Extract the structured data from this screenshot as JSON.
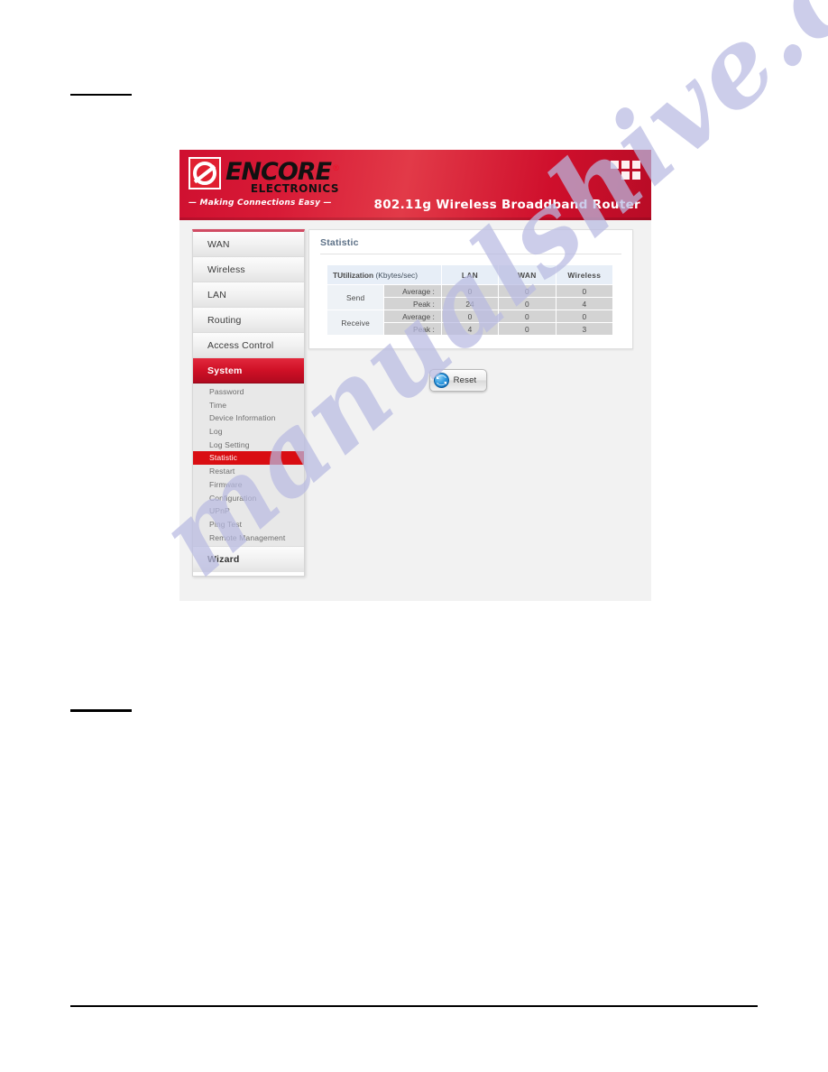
{
  "document": {
    "rules": {
      "top_rule": "",
      "mid_rule": "",
      "bottom_rule": ""
    },
    "watermark": "manualshive.com"
  },
  "router_ui": {
    "header": {
      "logo": {
        "brand": "ENCORE",
        "registered": "®",
        "sub_brand": "ELECTRONICS",
        "tagline": "— Making Connections Easy —"
      },
      "product_title": "802.11g Wireless Broaddband Router",
      "dots_icon": "grid-dots-icon"
    },
    "sidebar": {
      "main_items": [
        {
          "label": "WAN",
          "selected": false
        },
        {
          "label": "Wireless",
          "selected": false
        },
        {
          "label": "LAN",
          "selected": false
        },
        {
          "label": "Routing",
          "selected": false
        },
        {
          "label": "Access Control",
          "selected": false
        },
        {
          "label": "System",
          "selected": true
        }
      ],
      "system_submenu": [
        {
          "label": "Password",
          "selected": false
        },
        {
          "label": "Time",
          "selected": false
        },
        {
          "label": "Device Information",
          "selected": false
        },
        {
          "label": "Log",
          "selected": false
        },
        {
          "label": "Log Setting",
          "selected": false
        },
        {
          "label": "Statistic",
          "selected": true
        },
        {
          "label": "Restart",
          "selected": false
        },
        {
          "label": "Firmware",
          "selected": false
        },
        {
          "label": "Configuration",
          "selected": false
        },
        {
          "label": "UPnP",
          "selected": false
        },
        {
          "label": "Ping Test",
          "selected": false
        },
        {
          "label": "Remote Management",
          "selected": false
        }
      ],
      "wizard_item": {
        "label": "Wizard",
        "selected": false
      }
    },
    "content": {
      "panel_title": "Statistic",
      "table": {
        "corner_header_bold": "TUtilization",
        "corner_header_unit": "(Kbytes/sec)",
        "columns": [
          "LAN",
          "WAN",
          "Wireless"
        ],
        "groups": [
          {
            "label": "Send",
            "rows": [
              {
                "metric": "Average",
                "values": [
                  "0",
                  "0",
                  "0"
                ]
              },
              {
                "metric": "Peak",
                "values": [
                  "24",
                  "0",
                  "4"
                ]
              }
            ]
          },
          {
            "label": "Receive",
            "rows": [
              {
                "metric": "Average",
                "values": [
                  "0",
                  "0",
                  "0"
                ]
              },
              {
                "metric": "Peak",
                "values": [
                  "4",
                  "0",
                  "3"
                ]
              }
            ]
          }
        ]
      },
      "reset_button": {
        "label": "Reset",
        "icon": "refresh-icon"
      }
    }
  },
  "colors": {
    "brand_red": "#cf1026",
    "selected_sub_red": "#d90d12",
    "panel_title_blue": "#5d7187",
    "table_header_blue": "#e7eef7",
    "table_cell_gray": "#d3d3d3",
    "watermark": "#b9bbe2"
  }
}
